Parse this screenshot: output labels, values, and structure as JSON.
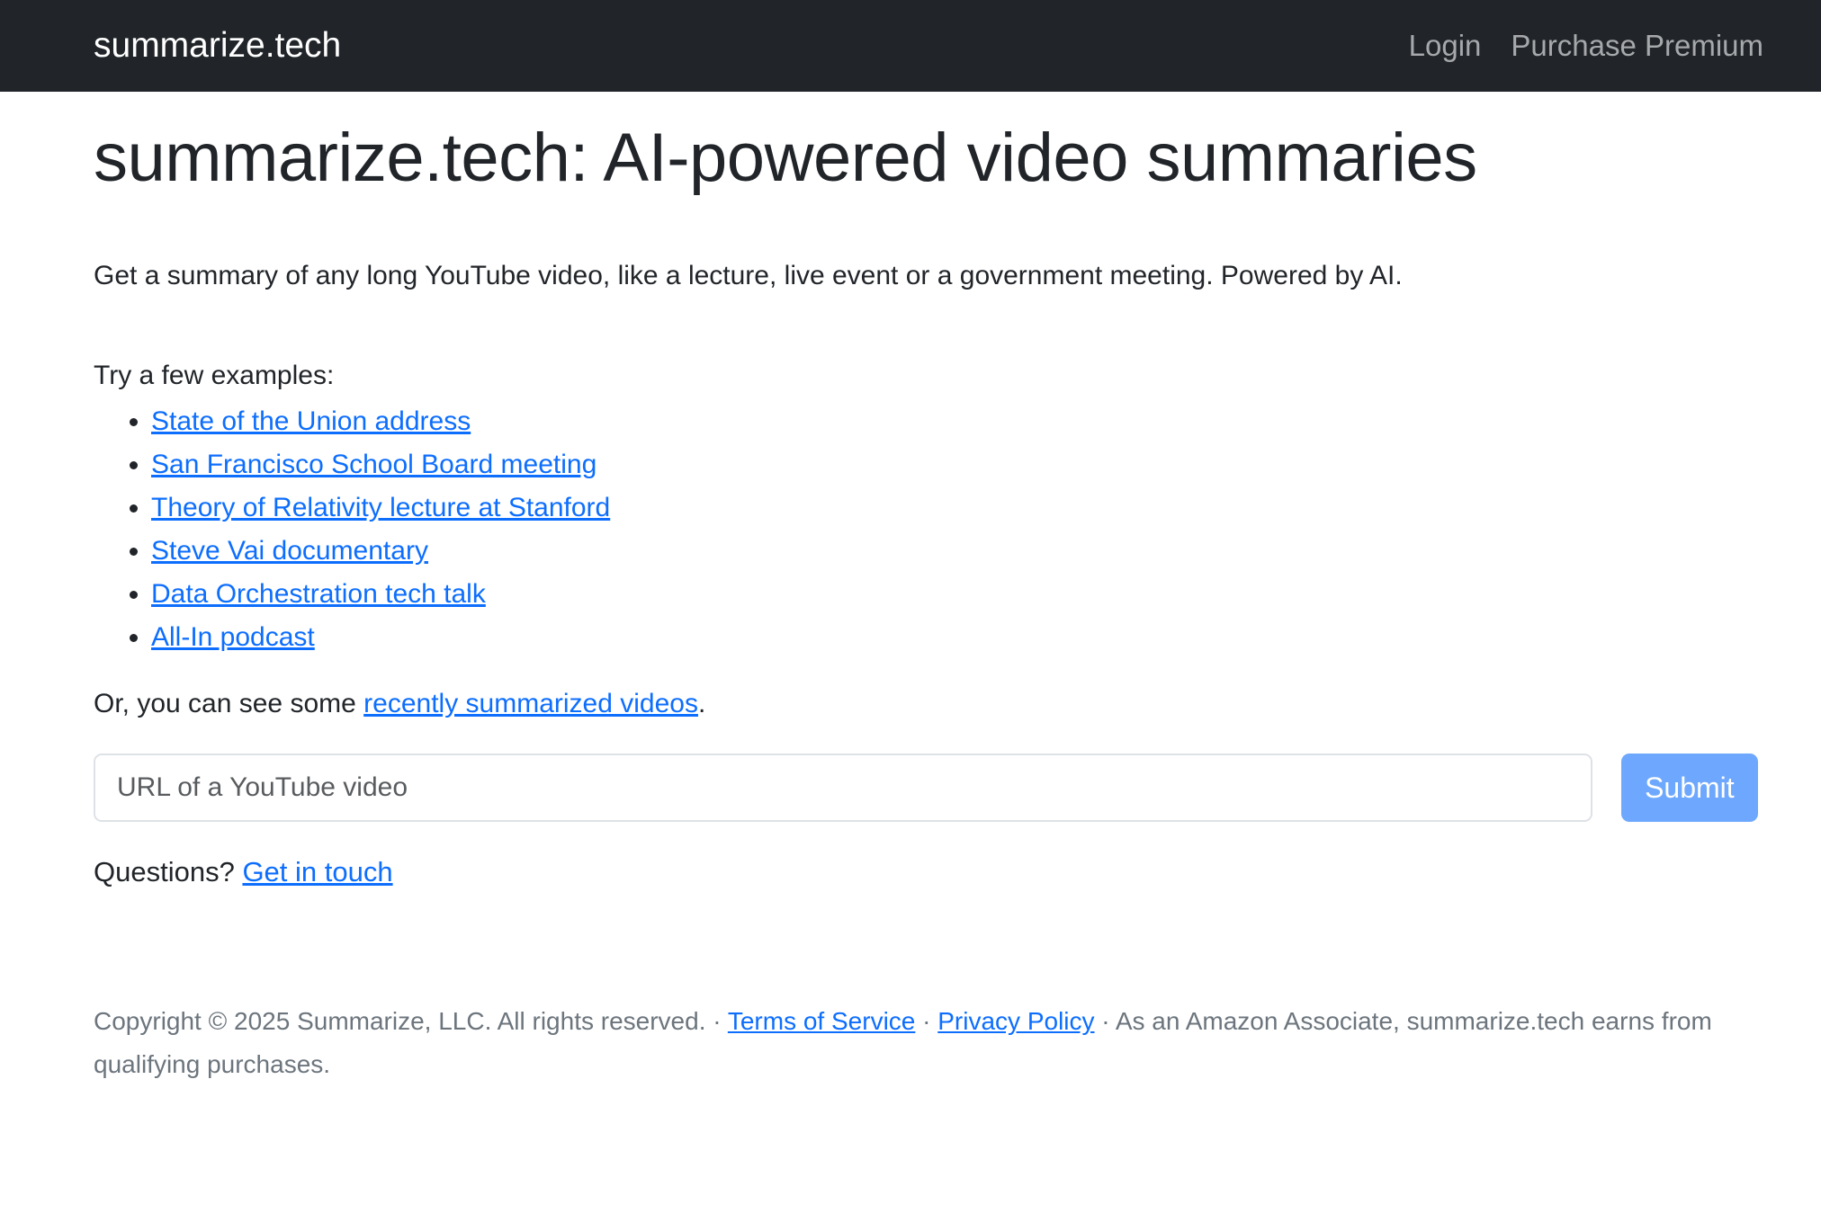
{
  "navbar": {
    "brand": "summarize.tech",
    "login": "Login",
    "premium": "Purchase Premium"
  },
  "main": {
    "title": "summarize.tech: AI-powered video summaries",
    "lead": "Get a summary of any long YouTube video, like a lecture, live event or a government meeting. Powered by AI.",
    "examples_intro": "Try a few examples:",
    "examples": [
      "State of the Union address",
      "San Francisco School Board meeting",
      "Theory of Relativity lecture at Stanford",
      "Steve Vai documentary",
      "Data Orchestration tech talk",
      "All-In podcast"
    ],
    "recent_prefix": "Or, you can see some ",
    "recent_link": "recently summarized videos",
    "recent_suffix": ".",
    "input_placeholder": "URL of a YouTube video",
    "submit": "Submit",
    "questions_prefix": "Questions? ",
    "questions_link": "Get in touch"
  },
  "footer": {
    "copyright": "Copyright © 2025 Summarize, LLC. All rights reserved. · ",
    "terms": "Terms of Service",
    "sep": " · ",
    "privacy": "Privacy Policy",
    "amazon": " · As an Amazon Associate, summarize.tech earns from qualifying purchases."
  },
  "colors": {
    "navbar_bg": "#212529",
    "link": "#0d6efd",
    "submit_bg": "#6ea8fe",
    "footer_text": "#6c757d"
  }
}
